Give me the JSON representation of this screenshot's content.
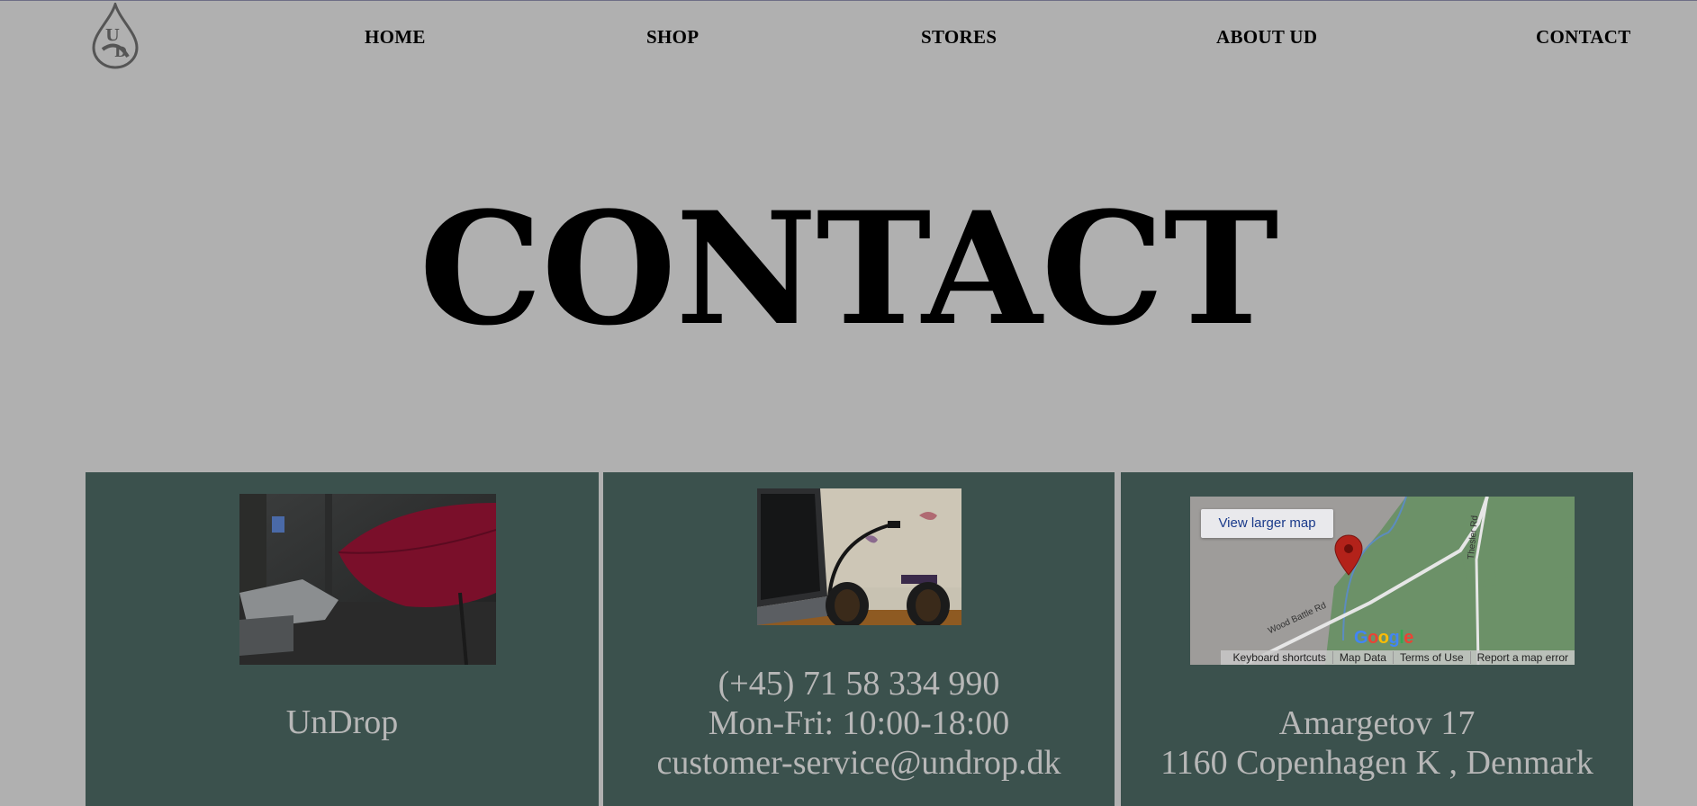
{
  "header": {
    "logo_icon": "drop-ud-logo-icon",
    "nav": [
      {
        "label": "HOME"
      },
      {
        "label": "SHOP"
      },
      {
        "label": "STORES"
      },
      {
        "label": "ABOUT UD"
      },
      {
        "label": "CONTACT"
      }
    ]
  },
  "hero": {
    "title": "CONTACT"
  },
  "panels": {
    "company": {
      "image": "red-umbrella-rain-photo",
      "name": "UnDrop"
    },
    "service": {
      "image": "headphones-laptop-desk-photo",
      "phone": "(+45) 71 58 334 990",
      "hours": "Mon-Fri: 10:00-18:00",
      "email": "customer-service@undrop.dk"
    },
    "location": {
      "map": {
        "button_label": "View larger map",
        "logo_text": "Google",
        "road_1": "Wood Battle Rd",
        "road_2": "Thesler Rd",
        "footer": [
          "Keyboard shortcuts",
          "Map Data",
          "Terms of Use",
          "Report a map error"
        ]
      },
      "street": "Amargetov 17",
      "city": "1160 Copenhagen K , Denmark"
    }
  },
  "colors": {
    "page_bg": "#b0b0b0",
    "panel_bg": "#3b514d",
    "panel_text": "#b7b7b7",
    "map_pin": "#b3221a"
  }
}
